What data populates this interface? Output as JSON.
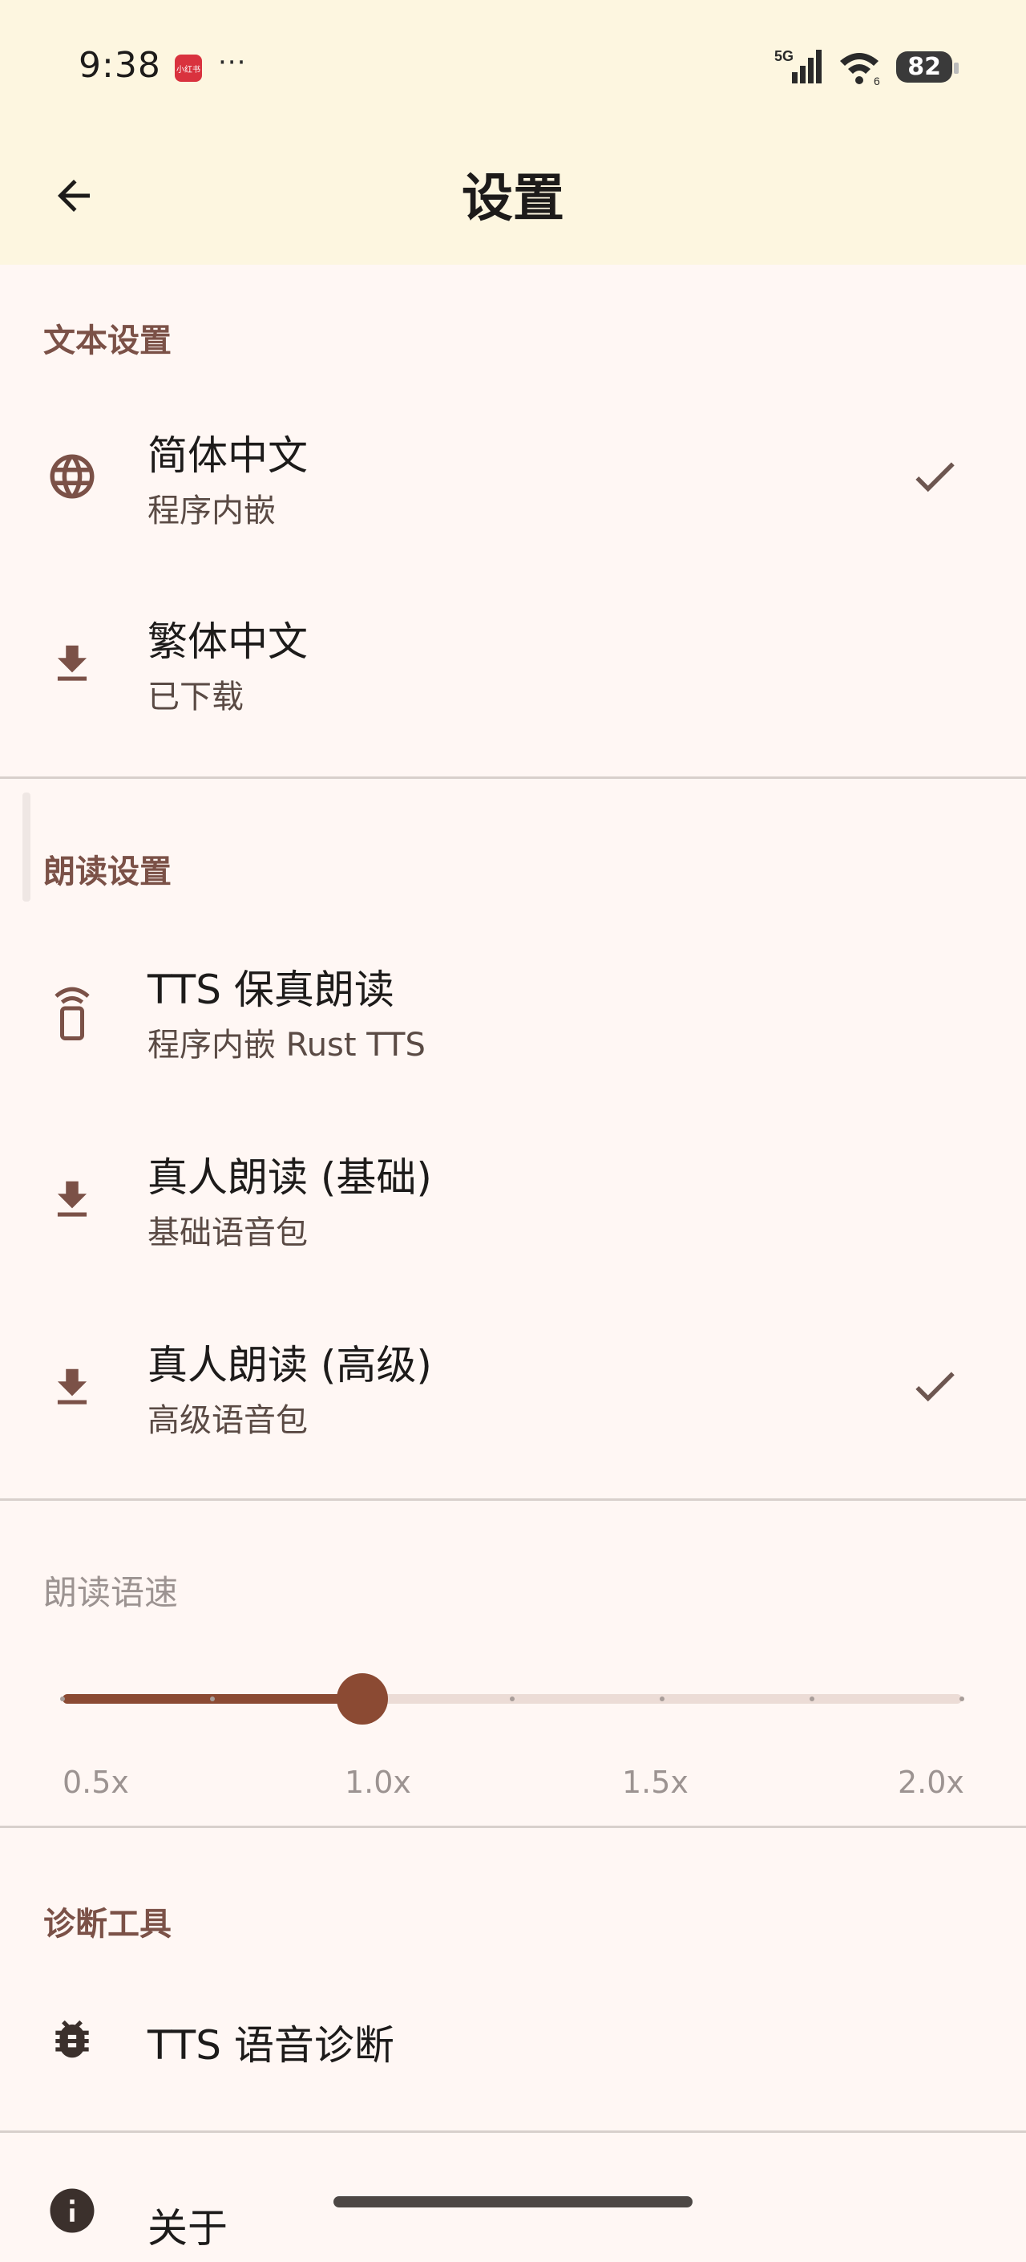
{
  "status_bar": {
    "time": "9:38",
    "app_badge": "小红书",
    "more": "···",
    "network": "5G",
    "wifi_sub": "6",
    "battery": "82"
  },
  "app_bar": {
    "title": "设置",
    "back_icon": "arrow-back-icon"
  },
  "text_settings": {
    "header": "文本设置",
    "items": [
      {
        "primary": "简体中文",
        "secondary": "程序内嵌",
        "icon": "globe-icon",
        "selected": true
      },
      {
        "primary": "繁体中文",
        "secondary": "已下载",
        "icon": "download-icon",
        "selected": false
      }
    ]
  },
  "reading_settings": {
    "header": "朗读设置",
    "items": [
      {
        "primary": "TTS 保真朗读",
        "secondary": "程序内嵌 Rust TTS",
        "icon": "phone-speaker-icon",
        "selected": false
      },
      {
        "primary": "真人朗读 (基础)",
        "secondary": "基础语音包",
        "icon": "download-icon",
        "selected": false
      },
      {
        "primary": "真人朗读 (高级)",
        "secondary": "高级语音包",
        "icon": "download-icon",
        "selected": true
      }
    ]
  },
  "speed": {
    "label": "朗读语速",
    "min": 0.5,
    "max": 2.0,
    "value": 1.0,
    "steps": 6,
    "tick_labels": [
      "0.5x",
      "1.0x",
      "1.5x",
      "2.0x"
    ]
  },
  "diagnostics": {
    "header": "诊断工具",
    "items": [
      {
        "primary": "TTS 语音诊断",
        "icon": "bug-icon"
      }
    ]
  },
  "about": {
    "primary": "关于",
    "icon": "info-icon"
  },
  "colors": {
    "accent": "#8b4a33",
    "header_text": "#7b5147",
    "app_bar_bg": "#fdf6e0",
    "page_bg": "#fff7f4"
  }
}
